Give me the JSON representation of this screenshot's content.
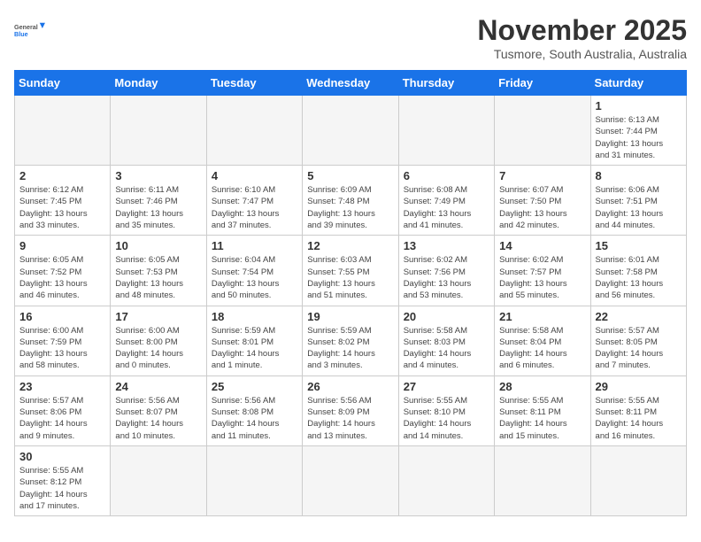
{
  "header": {
    "logo_general": "General",
    "logo_blue": "Blue",
    "month": "November 2025",
    "location": "Tusmore, South Australia, Australia"
  },
  "weekdays": [
    "Sunday",
    "Monday",
    "Tuesday",
    "Wednesday",
    "Thursday",
    "Friday",
    "Saturday"
  ],
  "days": [
    {
      "date": "",
      "info": ""
    },
    {
      "date": "",
      "info": ""
    },
    {
      "date": "",
      "info": ""
    },
    {
      "date": "",
      "info": ""
    },
    {
      "date": "",
      "info": ""
    },
    {
      "date": "",
      "info": ""
    },
    {
      "date": "1",
      "info": "Sunrise: 6:13 AM\nSunset: 7:44 PM\nDaylight: 13 hours\nand 31 minutes."
    },
    {
      "date": "2",
      "info": "Sunrise: 6:12 AM\nSunset: 7:45 PM\nDaylight: 13 hours\nand 33 minutes."
    },
    {
      "date": "3",
      "info": "Sunrise: 6:11 AM\nSunset: 7:46 PM\nDaylight: 13 hours\nand 35 minutes."
    },
    {
      "date": "4",
      "info": "Sunrise: 6:10 AM\nSunset: 7:47 PM\nDaylight: 13 hours\nand 37 minutes."
    },
    {
      "date": "5",
      "info": "Sunrise: 6:09 AM\nSunset: 7:48 PM\nDaylight: 13 hours\nand 39 minutes."
    },
    {
      "date": "6",
      "info": "Sunrise: 6:08 AM\nSunset: 7:49 PM\nDaylight: 13 hours\nand 41 minutes."
    },
    {
      "date": "7",
      "info": "Sunrise: 6:07 AM\nSunset: 7:50 PM\nDaylight: 13 hours\nand 42 minutes."
    },
    {
      "date": "8",
      "info": "Sunrise: 6:06 AM\nSunset: 7:51 PM\nDaylight: 13 hours\nand 44 minutes."
    },
    {
      "date": "9",
      "info": "Sunrise: 6:05 AM\nSunset: 7:52 PM\nDaylight: 13 hours\nand 46 minutes."
    },
    {
      "date": "10",
      "info": "Sunrise: 6:05 AM\nSunset: 7:53 PM\nDaylight: 13 hours\nand 48 minutes."
    },
    {
      "date": "11",
      "info": "Sunrise: 6:04 AM\nSunset: 7:54 PM\nDaylight: 13 hours\nand 50 minutes."
    },
    {
      "date": "12",
      "info": "Sunrise: 6:03 AM\nSunset: 7:55 PM\nDaylight: 13 hours\nand 51 minutes."
    },
    {
      "date": "13",
      "info": "Sunrise: 6:02 AM\nSunset: 7:56 PM\nDaylight: 13 hours\nand 53 minutes."
    },
    {
      "date": "14",
      "info": "Sunrise: 6:02 AM\nSunset: 7:57 PM\nDaylight: 13 hours\nand 55 minutes."
    },
    {
      "date": "15",
      "info": "Sunrise: 6:01 AM\nSunset: 7:58 PM\nDaylight: 13 hours\nand 56 minutes."
    },
    {
      "date": "16",
      "info": "Sunrise: 6:00 AM\nSunset: 7:59 PM\nDaylight: 13 hours\nand 58 minutes."
    },
    {
      "date": "17",
      "info": "Sunrise: 6:00 AM\nSunset: 8:00 PM\nDaylight: 14 hours\nand 0 minutes."
    },
    {
      "date": "18",
      "info": "Sunrise: 5:59 AM\nSunset: 8:01 PM\nDaylight: 14 hours\nand 1 minute."
    },
    {
      "date": "19",
      "info": "Sunrise: 5:59 AM\nSunset: 8:02 PM\nDaylight: 14 hours\nand 3 minutes."
    },
    {
      "date": "20",
      "info": "Sunrise: 5:58 AM\nSunset: 8:03 PM\nDaylight: 14 hours\nand 4 minutes."
    },
    {
      "date": "21",
      "info": "Sunrise: 5:58 AM\nSunset: 8:04 PM\nDaylight: 14 hours\nand 6 minutes."
    },
    {
      "date": "22",
      "info": "Sunrise: 5:57 AM\nSunset: 8:05 PM\nDaylight: 14 hours\nand 7 minutes."
    },
    {
      "date": "23",
      "info": "Sunrise: 5:57 AM\nSunset: 8:06 PM\nDaylight: 14 hours\nand 9 minutes."
    },
    {
      "date": "24",
      "info": "Sunrise: 5:56 AM\nSunset: 8:07 PM\nDaylight: 14 hours\nand 10 minutes."
    },
    {
      "date": "25",
      "info": "Sunrise: 5:56 AM\nSunset: 8:08 PM\nDaylight: 14 hours\nand 11 minutes."
    },
    {
      "date": "26",
      "info": "Sunrise: 5:56 AM\nSunset: 8:09 PM\nDaylight: 14 hours\nand 13 minutes."
    },
    {
      "date": "27",
      "info": "Sunrise: 5:55 AM\nSunset: 8:10 PM\nDaylight: 14 hours\nand 14 minutes."
    },
    {
      "date": "28",
      "info": "Sunrise: 5:55 AM\nSunset: 8:11 PM\nDaylight: 14 hours\nand 15 minutes."
    },
    {
      "date": "29",
      "info": "Sunrise: 5:55 AM\nSunset: 8:11 PM\nDaylight: 14 hours\nand 16 minutes."
    },
    {
      "date": "30",
      "info": "Sunrise: 5:55 AM\nSunset: 8:12 PM\nDaylight: 14 hours\nand 17 minutes."
    },
    {
      "date": "",
      "info": ""
    },
    {
      "date": "",
      "info": ""
    },
    {
      "date": "",
      "info": ""
    },
    {
      "date": "",
      "info": ""
    },
    {
      "date": "",
      "info": ""
    },
    {
      "date": "",
      "info": ""
    }
  ]
}
